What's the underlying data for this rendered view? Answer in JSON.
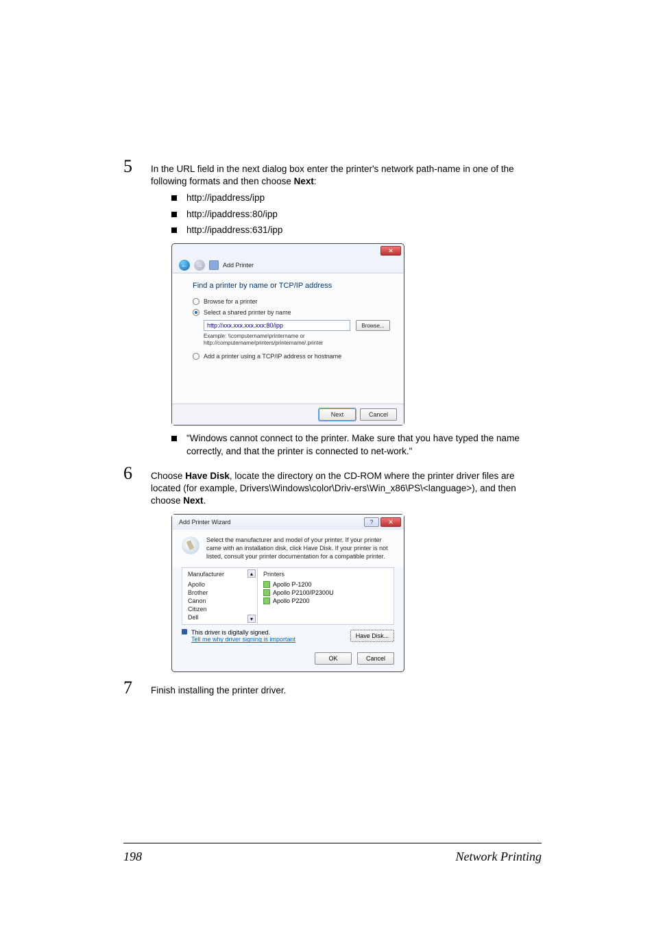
{
  "step5": {
    "num": "5",
    "text_pre": "In the URL field in the next dialog box enter the printer's network path-name in one of the following formats and then choose ",
    "text_bold": "Next",
    "text_post": ":",
    "bullets": [
      "http://ipaddress/ipp",
      "http://ipaddress:80/ipp",
      "http://ipaddress:631/ipp"
    ],
    "note": "\"Windows cannot connect to the printer. Make sure that you have typed the name correctly, and that the printer is connected to net-work.\""
  },
  "dlg1": {
    "header": "Add Printer",
    "heading": "Find a printer by name or TCP/IP address",
    "opt_browse": "Browse for a printer",
    "opt_shared": "Select a shared printer by name",
    "url_value": "http://xxx.xxx.xxx.xxx:80/ipp",
    "browse": "Browse...",
    "example1": "Example: \\\\computername\\printername or",
    "example2": "http://computername/printers/printername/.printer",
    "opt_tcp": "Add a printer using a TCP/IP address or hostname",
    "next": "Next",
    "cancel": "Cancel"
  },
  "step6": {
    "num": "6",
    "pre": "Choose ",
    "b1": "Have Disk",
    "mid": ", locate the directory on the CD-ROM where the printer driver files are located (for example, Drivers\\Windows\\color\\Driv-ers\\Win_x86\\PS\\<language>), and then choose ",
    "b2": "Next",
    "post": "."
  },
  "dlg2": {
    "title": "Add Printer Wizard",
    "instr": "Select the manufacturer and model of your printer. If your printer came with an installation disk, click Have Disk. If your printer is not listed, consult your printer documentation for a compatible printer.",
    "mfr_hdr": "Manufacturer",
    "printers_hdr": "Printers",
    "mfrs": [
      "Apollo",
      "Brother",
      "Canon",
      "Citizen",
      "Dell"
    ],
    "printers": [
      "Apollo P-1200",
      "Apollo P2100/P2300U",
      "Apollo P2200"
    ],
    "signed": "This driver is digitally signed.",
    "tell": "Tell me why driver signing is important",
    "have_disk": "Have Disk...",
    "ok": "OK",
    "cancel": "Cancel"
  },
  "step7": {
    "num": "7",
    "text": "Finish installing the printer driver."
  },
  "footer": {
    "page": "198",
    "title": "Network Printing"
  }
}
